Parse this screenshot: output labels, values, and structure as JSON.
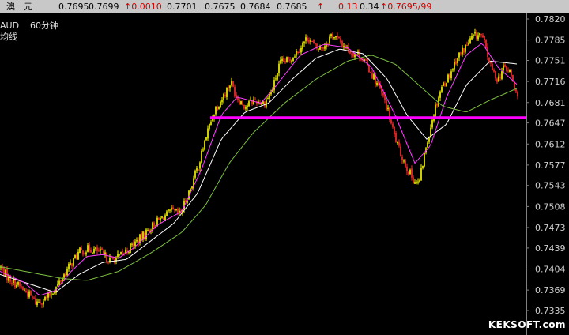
{
  "quote_bar": {
    "name": "澳　元",
    "open": "0.7695",
    "high": "0.7699",
    "change": "↑0.0010",
    "low": "0.7701",
    "prev": "0.7675",
    "v6": "0.7684",
    "last": "0.7685",
    "arrow": "↑",
    "v9": "0.13",
    "v10": "0.34",
    "bidask": "↑0.7695/99"
  },
  "info": {
    "symbol": "AUD",
    "period": "60分钟",
    "indicator": "均线"
  },
  "watermark": "KEKSOFT.com",
  "colors": {
    "up": "#ffff00",
    "down": "#ff3030",
    "ma_fast": "#ff40ff",
    "ma_mid": "#ffffff",
    "ma_slow": "#7ec040",
    "support": "#ff00ff",
    "axis": "#808080"
  },
  "chart_data": {
    "type": "candlestick",
    "title": "AUD 60分钟",
    "y_ticks": [
      "0.7820",
      "0.7785",
      "0.7751",
      "0.7716",
      "0.7681",
      "0.7647",
      "0.7612",
      "0.7577",
      "0.7543",
      "0.7508",
      "0.7473",
      "0.7439",
      "0.7404",
      "0.7369",
      "0.7335"
    ],
    "ylim": [
      0.7335,
      0.782
    ],
    "price_path": [
      [
        0,
        0.7408
      ],
      [
        10,
        0.739
      ],
      [
        22,
        0.7378
      ],
      [
        34,
        0.7365
      ],
      [
        46,
        0.7348
      ],
      [
        60,
        0.7356
      ],
      [
        72,
        0.7375
      ],
      [
        86,
        0.7405
      ],
      [
        100,
        0.7432
      ],
      [
        114,
        0.7438
      ],
      [
        126,
        0.7432
      ],
      [
        140,
        0.7418
      ],
      [
        152,
        0.7425
      ],
      [
        166,
        0.7442
      ],
      [
        180,
        0.7458
      ],
      [
        192,
        0.7475
      ],
      [
        206,
        0.749
      ],
      [
        218,
        0.75
      ],
      [
        228,
        0.7495
      ],
      [
        240,
        0.7535
      ],
      [
        252,
        0.758
      ],
      [
        262,
        0.763
      ],
      [
        272,
        0.767
      ],
      [
        282,
        0.769
      ],
      [
        292,
        0.7715
      ],
      [
        300,
        0.769
      ],
      [
        310,
        0.7675
      ],
      [
        322,
        0.7685
      ],
      [
        334,
        0.768
      ],
      [
        344,
        0.77
      ],
      [
        354,
        0.7745
      ],
      [
        366,
        0.7752
      ],
      [
        378,
        0.777
      ],
      [
        390,
        0.779
      ],
      [
        400,
        0.777
      ],
      [
        410,
        0.7775
      ],
      [
        420,
        0.7795
      ],
      [
        432,
        0.778
      ],
      [
        444,
        0.7765
      ],
      [
        456,
        0.776
      ],
      [
        468,
        0.7735
      ],
      [
        478,
        0.771
      ],
      [
        488,
        0.768
      ],
      [
        496,
        0.764
      ],
      [
        504,
        0.7605
      ],
      [
        514,
        0.7575
      ],
      [
        522,
        0.7555
      ],
      [
        530,
        0.7545
      ],
      [
        538,
        0.76
      ],
      [
        548,
        0.766
      ],
      [
        558,
        0.7705
      ],
      [
        568,
        0.7725
      ],
      [
        578,
        0.7755
      ],
      [
        590,
        0.7775
      ],
      [
        598,
        0.779
      ],
      [
        608,
        0.7795
      ],
      [
        614,
        0.7775
      ],
      [
        622,
        0.7735
      ],
      [
        630,
        0.772
      ],
      [
        638,
        0.774
      ],
      [
        646,
        0.773
      ],
      [
        652,
        0.77
      ],
      [
        656,
        0.7685
      ]
    ],
    "ma_fast_path": [
      [
        0,
        0.74
      ],
      [
        30,
        0.7382
      ],
      [
        50,
        0.736
      ],
      [
        70,
        0.7368
      ],
      [
        90,
        0.74
      ],
      [
        110,
        0.7425
      ],
      [
        130,
        0.7428
      ],
      [
        150,
        0.7422
      ],
      [
        170,
        0.744
      ],
      [
        200,
        0.7478
      ],
      [
        230,
        0.75
      ],
      [
        255,
        0.757
      ],
      [
        280,
        0.766
      ],
      [
        300,
        0.769
      ],
      [
        330,
        0.768
      ],
      [
        350,
        0.771
      ],
      [
        380,
        0.776
      ],
      [
        410,
        0.7778
      ],
      [
        440,
        0.7772
      ],
      [
        470,
        0.774
      ],
      [
        500,
        0.766
      ],
      [
        525,
        0.758
      ],
      [
        545,
        0.761
      ],
      [
        565,
        0.769
      ],
      [
        590,
        0.776
      ],
      [
        610,
        0.778
      ],
      [
        630,
        0.774
      ],
      [
        655,
        0.771
      ]
    ],
    "ma_mid_path": [
      [
        0,
        0.7395
      ],
      [
        40,
        0.7378
      ],
      [
        70,
        0.7365
      ],
      [
        100,
        0.7395
      ],
      [
        130,
        0.7415
      ],
      [
        160,
        0.742
      ],
      [
        190,
        0.745
      ],
      [
        220,
        0.748
      ],
      [
        250,
        0.753
      ],
      [
        280,
        0.762
      ],
      [
        310,
        0.7665
      ],
      [
        340,
        0.768
      ],
      [
        370,
        0.772
      ],
      [
        400,
        0.7755
      ],
      [
        430,
        0.777
      ],
      [
        460,
        0.7762
      ],
      [
        490,
        0.772
      ],
      [
        515,
        0.766
      ],
      [
        540,
        0.762
      ],
      [
        565,
        0.7645
      ],
      [
        590,
        0.771
      ],
      [
        620,
        0.775
      ],
      [
        655,
        0.7745
      ]
    ],
    "ma_slow_path": [
      [
        0,
        0.7408
      ],
      [
        40,
        0.7398
      ],
      [
        80,
        0.7388
      ],
      [
        110,
        0.7385
      ],
      [
        150,
        0.74
      ],
      [
        190,
        0.743
      ],
      [
        230,
        0.7465
      ],
      [
        260,
        0.751
      ],
      [
        290,
        0.758
      ],
      [
        320,
        0.763
      ],
      [
        360,
        0.768
      ],
      [
        400,
        0.772
      ],
      [
        440,
        0.775
      ],
      [
        470,
        0.776
      ],
      [
        500,
        0.7745
      ],
      [
        530,
        0.771
      ],
      [
        560,
        0.7675
      ],
      [
        590,
        0.7665
      ],
      [
        620,
        0.7685
      ],
      [
        655,
        0.7705
      ]
    ],
    "support_level": 0.7656
  }
}
